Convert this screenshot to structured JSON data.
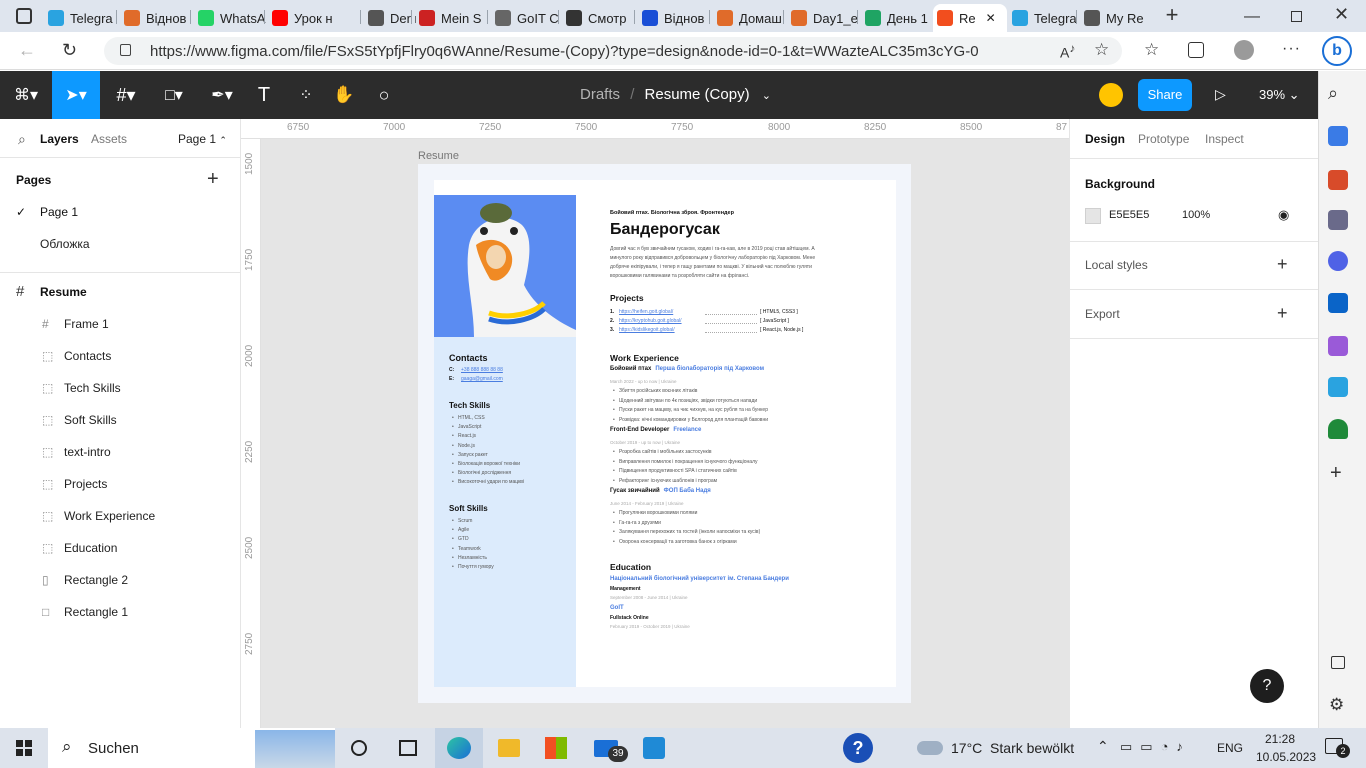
{
  "browser": {
    "tabs": [
      {
        "label": "Telegra",
        "color": "#2aa3e0"
      },
      {
        "label": "Віднов",
        "color": "#e06b2a"
      },
      {
        "label": "WhatsA",
        "color": "#25d366"
      },
      {
        "label": "Урок н",
        "color": "#ff0000"
      },
      {
        "label": "Der ne",
        "color": "#555555"
      },
      {
        "label": "Mein S",
        "color": "#cc2222"
      },
      {
        "label": "GoIT C",
        "color": "#666666"
      },
      {
        "label": "Смотр",
        "color": "#333333"
      },
      {
        "label": "Віднов",
        "color": "#1a4fd6"
      },
      {
        "label": "Домаш",
        "color": "#e06b2a"
      },
      {
        "label": "Day1_e",
        "color": "#e06b2a"
      },
      {
        "label": "День 1",
        "color": "#1fa463"
      },
      {
        "label": "Re",
        "color": "#f24e1e"
      },
      {
        "label": "Telegra",
        "color": "#2aa3e0"
      },
      {
        "label": "My Re",
        "color": "#555555"
      }
    ],
    "url": "https://www.figma.com/file/FSxS5tYpfjFlry0q6WAnne/Resume-(Copy)?type=design&node-id=0-1&t=WWazteALC35m3cYG-0"
  },
  "figma": {
    "breadcrumb_drafts": "Drafts",
    "breadcrumb_sep": "/",
    "file_name": "Resume (Copy)",
    "share": "Share",
    "zoom": "39%"
  },
  "left": {
    "tab_layers": "Layers",
    "tab_assets": "Assets",
    "page_select": "Page 1",
    "pages_title": "Pages",
    "pages": [
      "Page 1",
      "Обложка"
    ],
    "frame": "Resume",
    "layers": [
      "Frame 1",
      "Contacts",
      "Tech Skills",
      "Soft Skills",
      "text-intro",
      "Projects",
      "Work Experience",
      "Education",
      "Rectangle 2",
      "Rectangle 1"
    ]
  },
  "rulers": {
    "top": [
      "6750",
      "7000",
      "7250",
      "7500",
      "7750",
      "8000",
      "8250",
      "8500",
      "87"
    ],
    "left": [
      "1500",
      "1750",
      "2000",
      "2250",
      "2500",
      "2750"
    ]
  },
  "right": {
    "tabs": [
      "Design",
      "Prototype",
      "Inspect"
    ],
    "background_title": "Background",
    "bg_hex": "E5E5E5",
    "bg_opacity": "100%",
    "local_styles": "Local styles",
    "export": "Export",
    "help": "?"
  },
  "resume": {
    "frame_label": "Resume",
    "subtitle": "Бойовий птах. Біологічна зброя. Фронтендер",
    "name": "Бандерогусак",
    "intro": "Довгий час я був звичайним гусаком, ходив і га-га-кав, але в 2019 році став айтішцем. А\nминулого року відправився добровольцем у біологічну лабораторію під Харковом. Мене\nдобряче екіпірували, і тепер я гащу ракетами по мацкві. У вільний час полюблю гуляти\nворошковими галявинами та розробляти сайти на фрілансі.",
    "projects_title": "Projects",
    "projects": [
      {
        "n": "1.",
        "url": "https://heifen.goit.global/",
        "tech": "[ HTML5, CSS3 ]"
      },
      {
        "n": "2.",
        "url": "https://kryptohub.goit.global/",
        "tech": "[ JavaScript ]"
      },
      {
        "n": "3.",
        "url": "https://kidslikegoit.global/",
        "tech": "[ React.js, Node.js ]"
      }
    ],
    "work_title": "Work Experience",
    "jobs": [
      {
        "role": "Бойовий птах",
        "org": "Перша біолабораторія під Харковом",
        "meta": "March 2022 - up to now  |  Ukraine",
        "items": [
          "Збиття російських воєнних літаків",
          "Щоденний звітуван по 4к позиціях, звідки готуються напади",
          "Пуски ракет на мацкву, на чиє чихнув, на кус рубля та на бункер",
          "Розвідка: нічні командировки у Бєлгород для плантацій бавовни"
        ]
      },
      {
        "role": "Front-End Developer",
        "org": "Freelance",
        "meta": "October 2019 - up to now  |  Ukraine",
        "items": [
          "Розробка сайтів і мобільних застосунків",
          "Виправлення помилок і покращення існуючого функціоналу",
          "Підвищення продуктивності SPA і статичних сайтів",
          "Рефакторинг існуючих шаблонів і програм"
        ]
      },
      {
        "role": "Гусак звичайний",
        "org": "ФОП Баба Надя",
        "meta": "June 2014 - February 2019  |  Ukraine",
        "items": [
          "Прогулянки ворошковими полями",
          "Га-га-га з друзями",
          "Залякування перехожих та гостей (інколи напосміхи та кусів)",
          "Охорона консервації та заготовка банок з огірками"
        ]
      }
    ],
    "edu_title": "Education",
    "edu": [
      {
        "org": "Національний біологічний університет ім. Степана Бандери",
        "prog": "Management",
        "meta": "September 2008 - June 2014  |  Ukraine"
      },
      {
        "org": "GoIT",
        "prog": "Fullstack Online",
        "meta": "February 2019 - October 2019  |  Ukraine"
      }
    ],
    "contacts_title": "Contacts",
    "contacts": [
      {
        "k": "C:",
        "v": "+38 888 888 88 88"
      },
      {
        "k": "E:",
        "v": "gaaga@gmail.com"
      }
    ],
    "tech_title": "Tech Skills",
    "tech": [
      "HTML, CSS",
      "JavaScript",
      "React.js",
      "Node.js",
      "Запуск ракет",
      "Біолокація ворожої техніки",
      "Біологічні дослідження",
      "Високоточні удари по мацкві"
    ],
    "soft_title": "Soft Skills",
    "soft": [
      "Scrum",
      "Agile",
      "GTD",
      "Teamwork",
      "Незламність",
      "Почуття гумору"
    ]
  },
  "taskbar": {
    "search": "Suchen",
    "weather": "17°C  Stark bewölkt",
    "lang": "ENG",
    "time": "21:28",
    "date": "10.05.2023",
    "mail_badge": "39",
    "notif": "2"
  }
}
